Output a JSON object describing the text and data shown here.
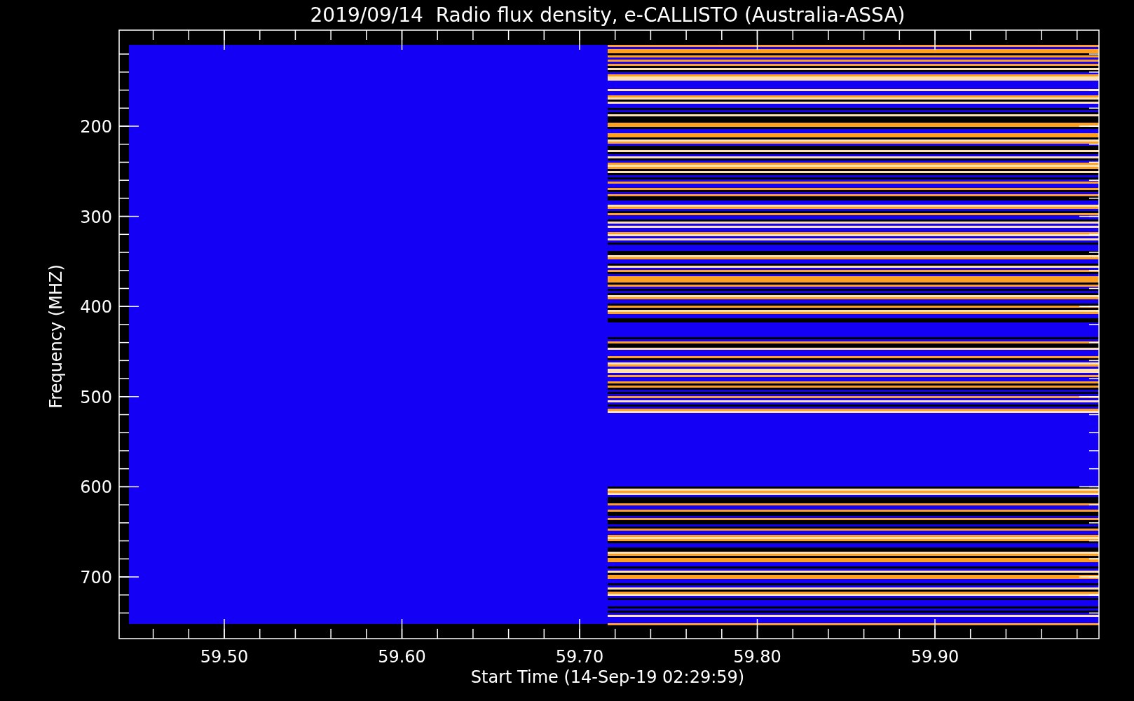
{
  "title": "2019/09/14  Radio flux density, e-CALLISTO (Australia-ASSA)",
  "y_axis": {
    "title": "Frequency (MHZ)",
    "ticks": [
      "200",
      "300",
      "400",
      "500",
      "600",
      "700"
    ]
  },
  "x_axis": {
    "title": "Start Time (14-Sep-19 02:29:59)",
    "ticks": [
      "59.50",
      "59.60",
      "59.70",
      "59.80",
      "59.90"
    ]
  }
}
